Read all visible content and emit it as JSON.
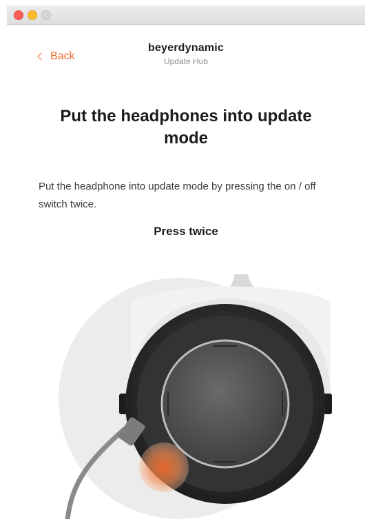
{
  "window": {
    "traffic_lights": [
      "close",
      "minimize",
      "zoom"
    ]
  },
  "header": {
    "back_label": "Back",
    "brand_name": "beyerdynamic",
    "brand_sub": "Update Hub"
  },
  "main": {
    "heading": "Put the headphones into update mode",
    "description": "Put the headphone into update mode by pressing the on / off switch twice.",
    "press_label": "Press twice"
  },
  "colors": {
    "accent": "#ef6a2a",
    "title": "#1b1b1b"
  }
}
